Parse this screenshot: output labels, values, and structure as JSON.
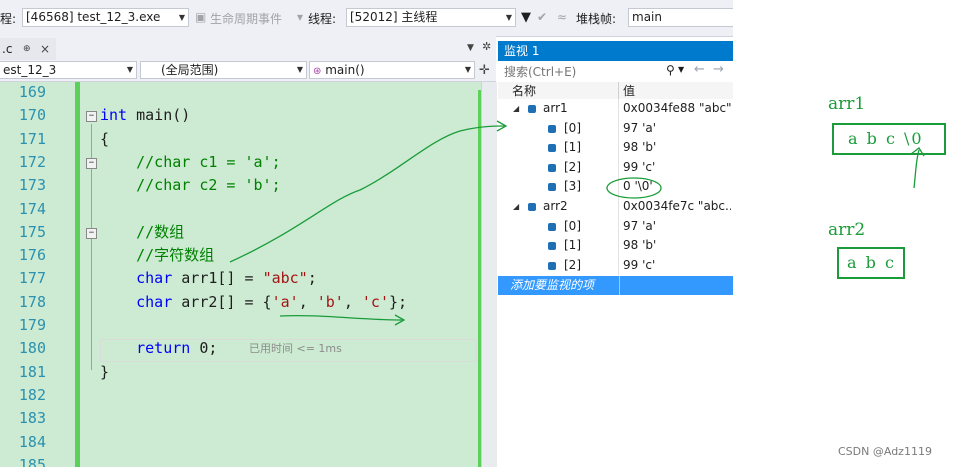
{
  "toolbar": {
    "process_label": "程:",
    "process_value": "[46568] test_12_3.exe",
    "lifecycle_label": "生命周期事件",
    "thread_label": "线程:",
    "thread_value": "[52012] 主线程",
    "stackframe_label": "堆栈帧:",
    "stackframe_value": "main"
  },
  "editor_tab": {
    "label": ".c"
  },
  "nav": {
    "project": "est_12_3",
    "scope": "(全局范围)",
    "function": "main()"
  },
  "code_lines": [
    {
      "num": "169"
    },
    {
      "num": "170",
      "kw": "int",
      "rest": " main()"
    },
    {
      "num": "171",
      "text": "{"
    },
    {
      "num": "172",
      "comment": "    //char c1 = 'a';"
    },
    {
      "num": "173",
      "comment": "    //char c2 = 'b';"
    },
    {
      "num": "174"
    },
    {
      "num": "175",
      "comment": "    //数组"
    },
    {
      "num": "176",
      "comment": "    //字符数组"
    },
    {
      "num": "177",
      "kw": "    char",
      "rest": " arr1[] = ",
      "str": "\"abc\"",
      "tail": ";"
    },
    {
      "num": "178",
      "kw": "    char",
      "rest": " arr2[] = {",
      "str": "'a'",
      "tail": ", ",
      "str2": "'b'",
      "tail2": ", ",
      "str3": "'c'",
      "tail3": "};"
    },
    {
      "num": "179"
    },
    {
      "num": "180",
      "kw": "    return",
      "rest": " 0;"
    },
    {
      "num": "181",
      "text": "}"
    },
    {
      "num": "182"
    },
    {
      "num": "183"
    },
    {
      "num": "184"
    },
    {
      "num": "185"
    }
  ],
  "time_hint": "已用时间 <= 1ms",
  "watch": {
    "title": "监视 1",
    "search_placeholder": "搜索(Ctrl+E)",
    "col_name": "名称",
    "col_value": "值",
    "rows": [
      {
        "name": "arr1",
        "value": "0x0034fe88 \"abc\""
      },
      {
        "name": "[0]",
        "value": "97 'a'"
      },
      {
        "name": "[1]",
        "value": "98 'b'"
      },
      {
        "name": "[2]",
        "value": "99 'c'"
      },
      {
        "name": "[3]",
        "value": "0 '\\0'"
      },
      {
        "name": "arr2",
        "value": "0x0034fe7c \"abc..."
      },
      {
        "name": "[0]",
        "value": "97 'a'"
      },
      {
        "name": "[1]",
        "value": "98 'b'"
      },
      {
        "name": "[2]",
        "value": "99 'c'"
      }
    ],
    "add_item": "添加要监视的项"
  },
  "annotations": {
    "arr1_label": "arr1",
    "arr1_box": "a b c \\0",
    "arr2_label": "arr2",
    "arr2_box": "a b c"
  },
  "watermark": "CSDN @Adz1119",
  "colors": {
    "accent": "#007acc",
    "annotation": "#1a9c3a",
    "editor_bg": "#ccebd2"
  }
}
